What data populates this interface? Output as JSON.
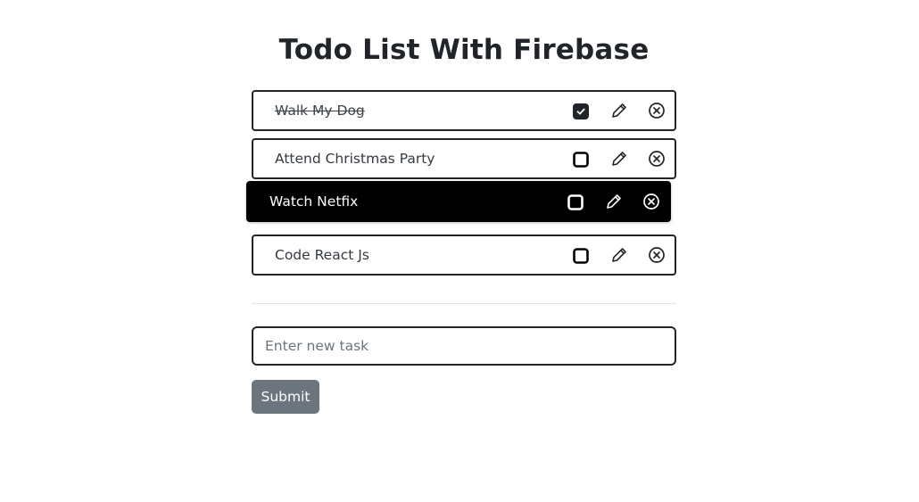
{
  "header": {
    "title": "Todo List With Firebase"
  },
  "todos": [
    {
      "label": "Walk My Dog",
      "completed": true
    },
    {
      "label": "Attend Christmas Party",
      "completed": false
    },
    {
      "label": "Watch Netfix",
      "completed": false,
      "dragging": true
    },
    {
      "label": "Code React Js",
      "completed": false
    }
  ],
  "icons": {
    "checkbox": "checkbox-icon",
    "edit": "pencil-icon",
    "delete": "close-circle-icon"
  },
  "form": {
    "placeholder": "Enter new task",
    "value": "",
    "submit_label": "Submit"
  },
  "colors": {
    "border": "#212529",
    "dragging_bg": "#000000",
    "submit_bg": "#6c757d"
  }
}
